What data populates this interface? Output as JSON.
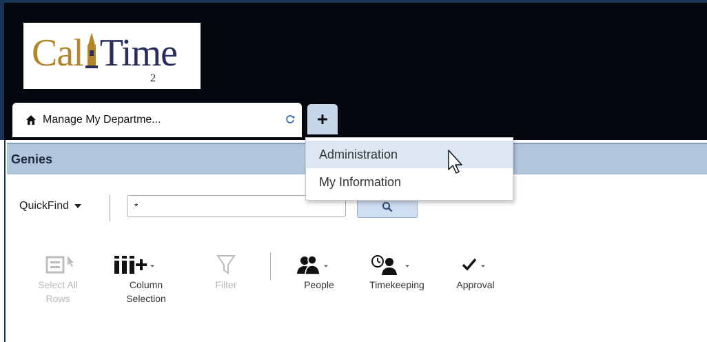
{
  "app": {
    "logo": {
      "brand_a": "Cal",
      "brand_b": "Time",
      "version": "2"
    }
  },
  "tabs": [
    {
      "label": "Manage My Departme...",
      "icon": "home-icon",
      "action_icon": "refresh-icon"
    }
  ],
  "add_tab": {
    "icon": "plus-icon"
  },
  "menu": {
    "items": [
      {
        "label": "Administration",
        "hovered": true
      },
      {
        "label": "My Information",
        "hovered": false
      }
    ]
  },
  "genies": {
    "title": "Genies"
  },
  "quickfind": {
    "label": "QuickFind",
    "value": "*",
    "search_icon": "search-icon"
  },
  "toolbar": {
    "items": [
      {
        "label": "Select All Rows",
        "icon": "select-all-rows-icon",
        "enabled": false
      },
      {
        "label": "Column Selection",
        "icon": "column-selection-icon",
        "enabled": true
      },
      {
        "label": "Filter",
        "icon": "filter-icon",
        "enabled": false
      },
      {
        "label": "People",
        "icon": "people-icon",
        "enabled": true
      },
      {
        "label": "Timekeeping",
        "icon": "timekeeping-icon",
        "enabled": true
      },
      {
        "label": "Approval",
        "icon": "approval-icon",
        "enabled": true
      }
    ]
  },
  "colors": {
    "header_bg": "#05070f",
    "genies_bar": "#b1c6dd",
    "menu_hover": "#dce7f3",
    "logo_gold": "#b3862a",
    "logo_navy": "#2b2e5c"
  }
}
